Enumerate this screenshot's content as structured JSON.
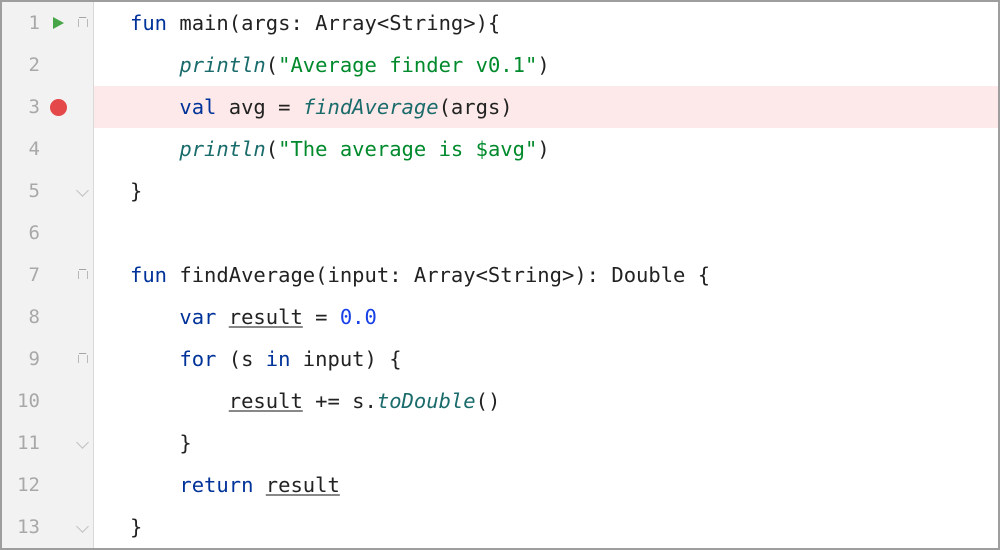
{
  "editor": {
    "lines": [
      {
        "num": "1",
        "run": true,
        "bp": false,
        "fold": "minus",
        "tokens": [
          [
            "keyword",
            "fun"
          ],
          [
            "text",
            " "
          ],
          [
            "ident",
            "main"
          ],
          [
            "text",
            "(args: Array<String>){"
          ]
        ]
      },
      {
        "num": "2",
        "run": false,
        "bp": false,
        "fold": "",
        "indent": 1,
        "tokens": [
          [
            "fn",
            "println"
          ],
          [
            "text",
            "("
          ],
          [
            "str",
            "\"Average finder v0.1\""
          ],
          [
            "text",
            ")"
          ]
        ]
      },
      {
        "num": "3",
        "run": false,
        "bp": true,
        "fold": "",
        "indent": 1,
        "tokens": [
          [
            "keyword",
            "val"
          ],
          [
            "text",
            " avg = "
          ],
          [
            "fn",
            "findAverage"
          ],
          [
            "text",
            "(args)"
          ]
        ]
      },
      {
        "num": "4",
        "run": false,
        "bp": false,
        "fold": "",
        "indent": 1,
        "tokens": [
          [
            "fn",
            "println"
          ],
          [
            "text",
            "("
          ],
          [
            "str",
            "\"The average is $avg\""
          ],
          [
            "text",
            ")"
          ]
        ]
      },
      {
        "num": "5",
        "run": false,
        "bp": false,
        "fold": "end",
        "tokens": [
          [
            "text",
            "}"
          ]
        ]
      },
      {
        "num": "6",
        "run": false,
        "bp": false,
        "fold": "",
        "tokens": []
      },
      {
        "num": "7",
        "run": false,
        "bp": false,
        "fold": "minus",
        "tokens": [
          [
            "keyword",
            "fun"
          ],
          [
            "text",
            " "
          ],
          [
            "ident",
            "findAverage"
          ],
          [
            "text",
            "(input: Array<String>): Double {"
          ]
        ]
      },
      {
        "num": "8",
        "run": false,
        "bp": false,
        "fold": "",
        "indent": 1,
        "tokens": [
          [
            "keyword",
            "var"
          ],
          [
            "text",
            " "
          ],
          [
            "under",
            "result"
          ],
          [
            "text",
            " = "
          ],
          [
            "num",
            "0.0"
          ]
        ]
      },
      {
        "num": "9",
        "run": false,
        "bp": false,
        "fold": "minus",
        "indent": 1,
        "tokens": [
          [
            "keyword",
            "for"
          ],
          [
            "text",
            " (s "
          ],
          [
            "keyword",
            "in"
          ],
          [
            "text",
            " input) {"
          ]
        ]
      },
      {
        "num": "10",
        "run": false,
        "bp": false,
        "fold": "",
        "indent": 2,
        "guide": 1,
        "tokens": [
          [
            "under",
            "result"
          ],
          [
            "text",
            " += s."
          ],
          [
            "fn",
            "toDouble"
          ],
          [
            "text",
            "()"
          ]
        ]
      },
      {
        "num": "11",
        "run": false,
        "bp": false,
        "fold": "end",
        "indent": 1,
        "tokens": [
          [
            "text",
            "}"
          ]
        ]
      },
      {
        "num": "12",
        "run": false,
        "bp": false,
        "fold": "",
        "indent": 1,
        "tokens": [
          [
            "keyword",
            "return"
          ],
          [
            "text",
            " "
          ],
          [
            "under",
            "result"
          ]
        ]
      },
      {
        "num": "13",
        "run": false,
        "bp": false,
        "fold": "end",
        "tokens": [
          [
            "text",
            "}"
          ]
        ]
      }
    ]
  }
}
